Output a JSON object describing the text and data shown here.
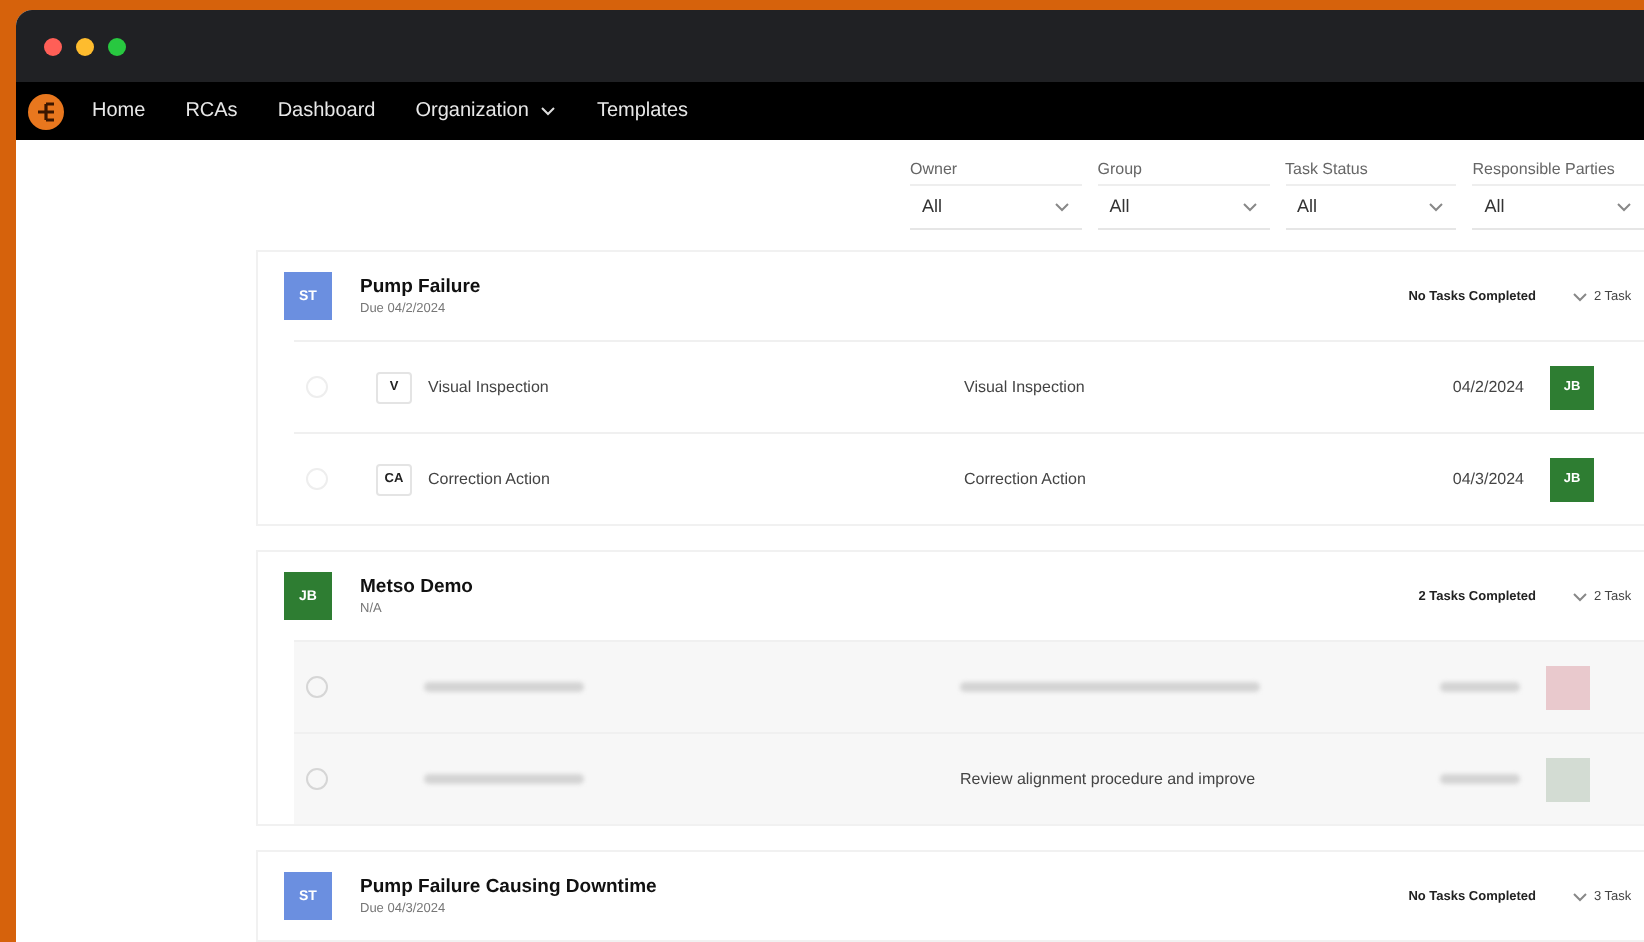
{
  "window": {
    "controls": [
      {
        "color": "#ff5f57"
      },
      {
        "color": "#febc2e"
      },
      {
        "color": "#28c840"
      }
    ]
  },
  "nav": {
    "items": [
      {
        "label": "Home",
        "has_menu": false
      },
      {
        "label": "RCAs",
        "has_menu": false
      },
      {
        "label": "Dashboard",
        "has_menu": false
      },
      {
        "label": "Organization",
        "has_menu": true
      },
      {
        "label": "Templates",
        "has_menu": false
      }
    ]
  },
  "filters": [
    {
      "label": "Owner",
      "value": "All"
    },
    {
      "label": "Group",
      "value": "All"
    },
    {
      "label": "Task Status",
      "value": "All"
    },
    {
      "label": "Responsible Parties",
      "value": "All"
    }
  ],
  "groups": [
    {
      "avatar": {
        "initials": "ST",
        "color": "#6b8fe0"
      },
      "title": "Pump Failure",
      "subtitle": "Due 04/2/2024",
      "status": "No Tasks Completed",
      "count": "2 Task",
      "rows": [
        {
          "tag": "V",
          "name": "Visual Inspection",
          "description": "Visual Inspection",
          "date": "04/2/2024",
          "assignee": {
            "initials": "JB",
            "color": "#2e7d32"
          },
          "faded": false
        },
        {
          "tag": "CA",
          "name": "Correction Action",
          "description": "Correction Action",
          "date": "04/3/2024",
          "assignee": {
            "initials": "JB",
            "color": "#2e7d32"
          },
          "faded": false
        }
      ]
    },
    {
      "avatar": {
        "initials": "JB",
        "color": "#2e7d32"
      },
      "title": "Metso Demo",
      "subtitle": "N/A",
      "status": "2 Tasks Completed",
      "count": "2 Task",
      "rows": [
        {
          "assignee": {
            "color": "#e9c9cd"
          },
          "faded": true
        },
        {
          "description": "Review alignment procedure and improve",
          "assignee": {
            "color": "#d3dcd3"
          },
          "faded": true
        }
      ]
    },
    {
      "avatar": {
        "initials": "ST",
        "color": "#6b8fe0"
      },
      "title": "Pump Failure Causing Downtime",
      "subtitle": "Due 04/3/2024",
      "status": "No Tasks Completed",
      "count": "3 Task"
    }
  ]
}
